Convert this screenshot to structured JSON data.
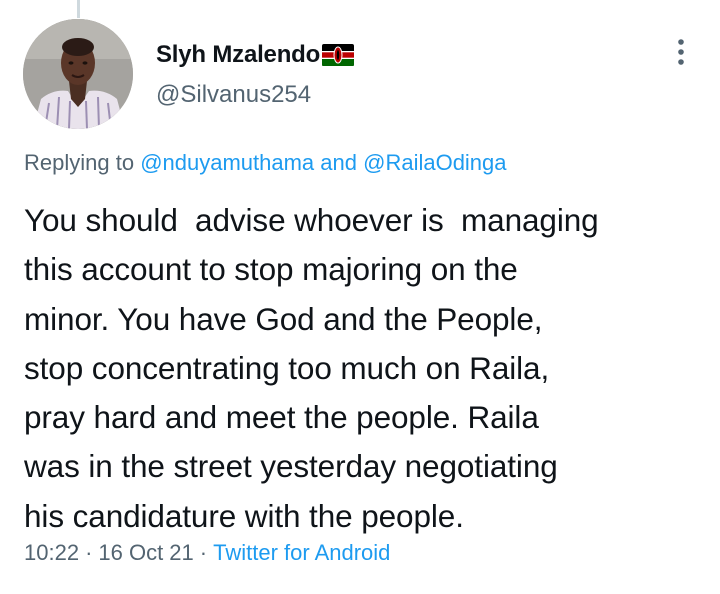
{
  "author": {
    "display_name": "Slyh Mzalendo",
    "flag_icon": "kenya-flag-icon",
    "handle": "@Silvanus254"
  },
  "menu": {
    "icon": "more-vertical-icon"
  },
  "reply": {
    "prefix": "Replying to ",
    "mention_1": "@nduyamuthama",
    "joiner": " and ",
    "mention_2": "@RailaOdinga"
  },
  "tweet": {
    "text": "You should  advise whoever is  managing\nthis account to stop majoring on the\nminor. You have God and the People,\nstop concentrating too much on Raila,\npray hard and meet the people. Raila\nwas in the street yesterday negotiating\nhis candidature with the people."
  },
  "meta": {
    "time": "10:22",
    "separator_1": "·",
    "date": "16 Oct 21",
    "separator_2": "·",
    "source": "Twitter for Android"
  },
  "colors": {
    "text": "#0f1419",
    "secondary": "#536471",
    "link": "#1d9bf0"
  }
}
